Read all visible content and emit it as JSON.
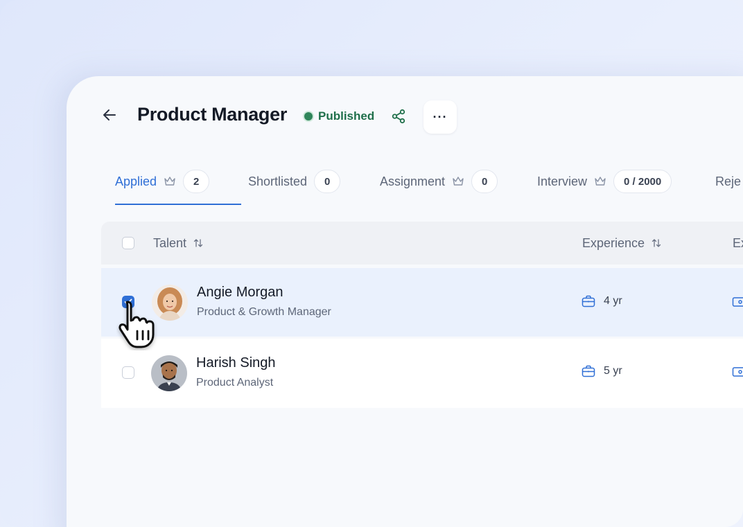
{
  "header": {
    "title": "Product Manager",
    "status": "Published",
    "more_label": "···"
  },
  "tabs": [
    {
      "label": "Applied",
      "count": "2",
      "crown": true,
      "active": true
    },
    {
      "label": "Shortlisted",
      "count": "0",
      "crown": false,
      "active": false
    },
    {
      "label": "Assignment",
      "count": "0",
      "crown": true,
      "active": false
    },
    {
      "label": "Interview",
      "count": "0 / 2000",
      "crown": true,
      "active": false
    },
    {
      "label": "Reje",
      "count": "",
      "crown": false,
      "active": false
    }
  ],
  "table": {
    "columns": {
      "talent": "Talent",
      "experience": "Experience",
      "extra": "Ex"
    },
    "rows": [
      {
        "name": "Angie Morgan",
        "role": "Product & Growth Manager",
        "experience": "4 yr",
        "selected": true
      },
      {
        "name": "Harish Singh",
        "role": "Product Analyst",
        "experience": "5 yr",
        "selected": false
      }
    ]
  },
  "colors": {
    "accent": "#2f6fd6",
    "status_green": "#1f6f4a",
    "selected_row": "#eaf1fd"
  },
  "icons": [
    "arrow-left-icon",
    "share-icon",
    "more-icon",
    "crown-icon",
    "sort-icon",
    "briefcase-icon",
    "wallet-icon",
    "hand-pointer-icon"
  ]
}
